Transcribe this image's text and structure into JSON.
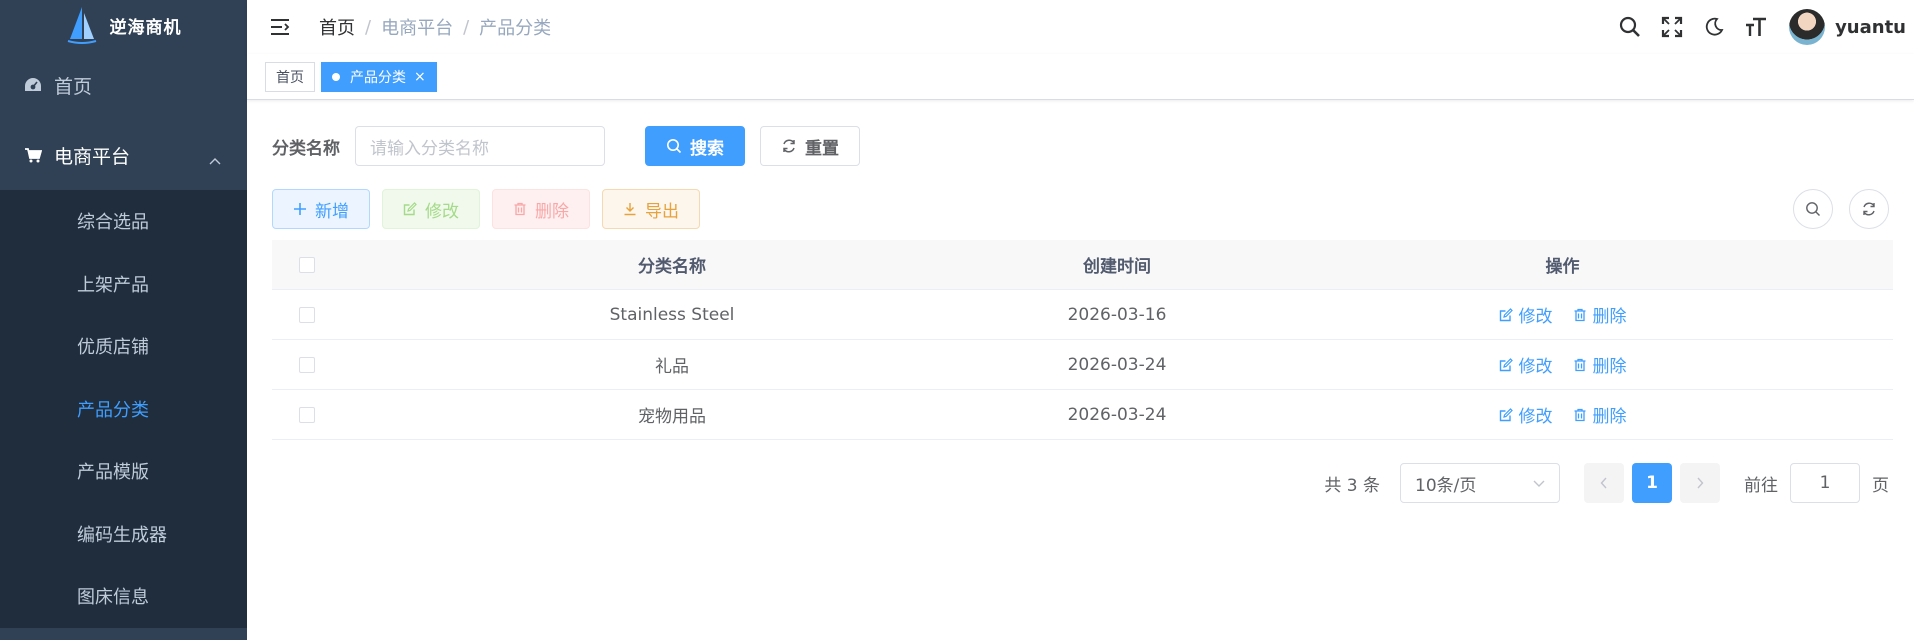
{
  "app": {
    "title": "逆海商机"
  },
  "sidebar": {
    "items": [
      {
        "label": "首页",
        "icon": "dashboard-icon"
      },
      {
        "label": "电商平台",
        "icon": "cart-icon",
        "expanded": true
      }
    ],
    "sub_items": [
      {
        "label": "综合选品",
        "active": false
      },
      {
        "label": "上架产品",
        "active": false
      },
      {
        "label": "优质店铺",
        "active": false
      },
      {
        "label": "产品分类",
        "active": true
      },
      {
        "label": "产品模版",
        "active": false
      },
      {
        "label": "编码生成器",
        "active": false
      },
      {
        "label": "图床信息",
        "active": false
      }
    ]
  },
  "navbar": {
    "breadcrumb": [
      "首页",
      "电商平台",
      "产品分类"
    ],
    "username": "yuantu"
  },
  "tags": [
    {
      "label": "首页",
      "active": false
    },
    {
      "label": "产品分类",
      "active": true,
      "close": "×"
    }
  ],
  "search": {
    "label": "分类名称",
    "placeholder": "请输入分类名称",
    "search_button": "搜索",
    "reset_button": "重置"
  },
  "actions": {
    "add": "新增",
    "edit": "修改",
    "delete": "删除",
    "export": "导出"
  },
  "table": {
    "headers": {
      "name": "分类名称",
      "time": "创建时间",
      "op": "操作"
    },
    "rows": [
      {
        "name": "Stainless Steel",
        "time": "2026-03-16"
      },
      {
        "name": "礼品",
        "time": "2026-03-24"
      },
      {
        "name": "宠物用品",
        "time": "2026-03-24"
      }
    ],
    "row_edit": "修改",
    "row_delete": "删除"
  },
  "pagination": {
    "total_text": "共 3 条",
    "page_size": "10条/页",
    "current_page": "1",
    "goto_prefix": "前往",
    "goto_value": "1",
    "goto_suffix": "页"
  },
  "colors": {
    "sidebar_bg": "#304156",
    "submenu_bg": "#1f2d3d",
    "primary": "#409eff"
  }
}
